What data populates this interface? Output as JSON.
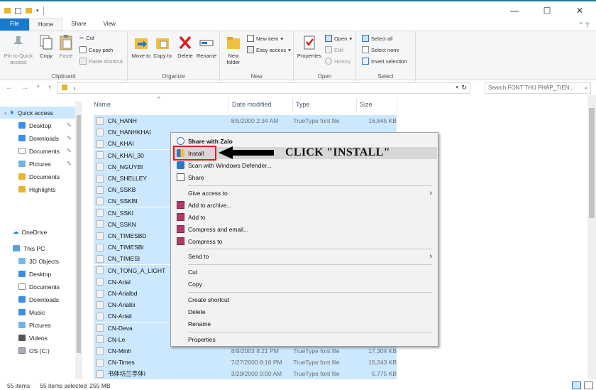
{
  "window": {
    "minimize": "—",
    "maximize": "☐",
    "close": "✕"
  },
  "tabs": [
    "File",
    "Home",
    "Share",
    "View"
  ],
  "ribbon": {
    "clipboard": {
      "name": "Clipboard",
      "pin": "Pin to Quick access",
      "copy": "Copy",
      "paste": "Paste",
      "cut": "Cut",
      "copy_path": "Copy path",
      "paste_shortcut": "Paste shortcut"
    },
    "organize": {
      "name": "Organize",
      "move_to": "Move to",
      "copy_to": "Copy to",
      "delete": "Delete",
      "rename": "Rename"
    },
    "new": {
      "name": "New",
      "new_folder": "New folder",
      "new_item": "New item",
      "easy_access": "Easy access"
    },
    "open": {
      "name": "Open",
      "properties": "Properties",
      "open": "Open",
      "edit": "Edit",
      "history": "History"
    },
    "select": {
      "name": "Select",
      "select_all": "Select all",
      "select_none": "Select none",
      "invert": "Invert selection"
    }
  },
  "address": {
    "path_arrow": "›",
    "search_placeholder": "Search FONT THU PHAP_TIEN..."
  },
  "nav": {
    "quick_access": "Quick access",
    "qa_items": [
      "Desktop",
      "Downloads",
      "Documents",
      "Pictures",
      "Documents",
      "Highlights"
    ],
    "onedrive": "OneDrive",
    "this_pc": "This PC",
    "pc_items": [
      "3D Objects",
      "Desktop",
      "Documents",
      "Downloads",
      "Music",
      "Pictures",
      "Videos",
      "OS (C:)"
    ]
  },
  "columns": {
    "name": "Name",
    "date": "Date modified",
    "type": "Type",
    "size": "Size"
  },
  "files": [
    {
      "name": "CN_HANH",
      "date": "8/5/2000 2:34 AM",
      "type": "TrueType font file",
      "size": "16,845 KB"
    },
    {
      "name": "CN_HANHKHAI",
      "date": "",
      "type": "",
      "size": ""
    },
    {
      "name": "CN_KHAI",
      "date": "",
      "type": "",
      "size": ""
    },
    {
      "name": "CN_KHAI_30",
      "date": "",
      "type": "",
      "size": ""
    },
    {
      "name": "CN_NGUYBI",
      "date": "",
      "type": "",
      "size": ""
    },
    {
      "name": "CN_SHELLEY",
      "date": "",
      "type": "",
      "size": ""
    },
    {
      "name": "CN_SSKB",
      "date": "",
      "type": "",
      "size": ""
    },
    {
      "name": "CN_SSKBI",
      "date": "",
      "type": "",
      "size": ""
    },
    {
      "name": "CN_SSKI",
      "date": "",
      "type": "",
      "size": ""
    },
    {
      "name": "CN_SSKN",
      "date": "",
      "type": "",
      "size": ""
    },
    {
      "name": "CN_TIMESBD",
      "date": "",
      "type": "",
      "size": ""
    },
    {
      "name": "CN_TIMESBI",
      "date": "",
      "type": "",
      "size": ""
    },
    {
      "name": "CN_TIMESI",
      "date": "",
      "type": "",
      "size": ""
    },
    {
      "name": "CN_TONG_A_LIGHT",
      "date": "",
      "type": "",
      "size": ""
    },
    {
      "name": "CN-Arial",
      "date": "",
      "type": "",
      "size": ""
    },
    {
      "name": "CN-Arialbd",
      "date": "",
      "type": "",
      "size": ""
    },
    {
      "name": "CN-Arialbi",
      "date": "",
      "type": "",
      "size": ""
    },
    {
      "name": "CN-Ariali",
      "date": "",
      "type": "",
      "size": ""
    },
    {
      "name": "CN-Deva",
      "date": "",
      "type": "",
      "size": ""
    },
    {
      "name": "CN-Le",
      "date": "",
      "type": "",
      "size": ""
    },
    {
      "name": "CN-Minh",
      "date": "8/9/2003 8:21 PM",
      "type": "TrueType font file",
      "size": "17,304 KB"
    },
    {
      "name": "CN-Times",
      "date": "7/27/2000 8:16 PM",
      "type": "TrueType font file",
      "size": "15,243 KB"
    },
    {
      "name": "书体坊兰亭体I",
      "date": "3/29/2009 9:00 AM",
      "type": "TrueType font file",
      "size": "5,775 KB"
    }
  ],
  "context_menu": {
    "share_zalo": "Share with Zalo",
    "install": "Install",
    "scan": "Scan with Windows Defender...",
    "share": "Share",
    "give_access": "Give access to",
    "add_archive": "Add to archive...",
    "add_to": "Add to",
    "compress_email": "Compress and email...",
    "compress_to": "Compress to",
    "send_to": "Send to",
    "cut": "Cut",
    "copy": "Copy",
    "create_shortcut": "Create shortcut",
    "delete": "Delete",
    "rename": "Rename",
    "properties": "Properties"
  },
  "callout": "CLICK \"INSTALL\"",
  "status": {
    "items": "55 items",
    "selected": "55 items selected",
    "size": "255 MB"
  },
  "colors": {
    "accent": "#1979ca",
    "selection": "#cce8ff",
    "highlight_box": "#e21b1b"
  }
}
